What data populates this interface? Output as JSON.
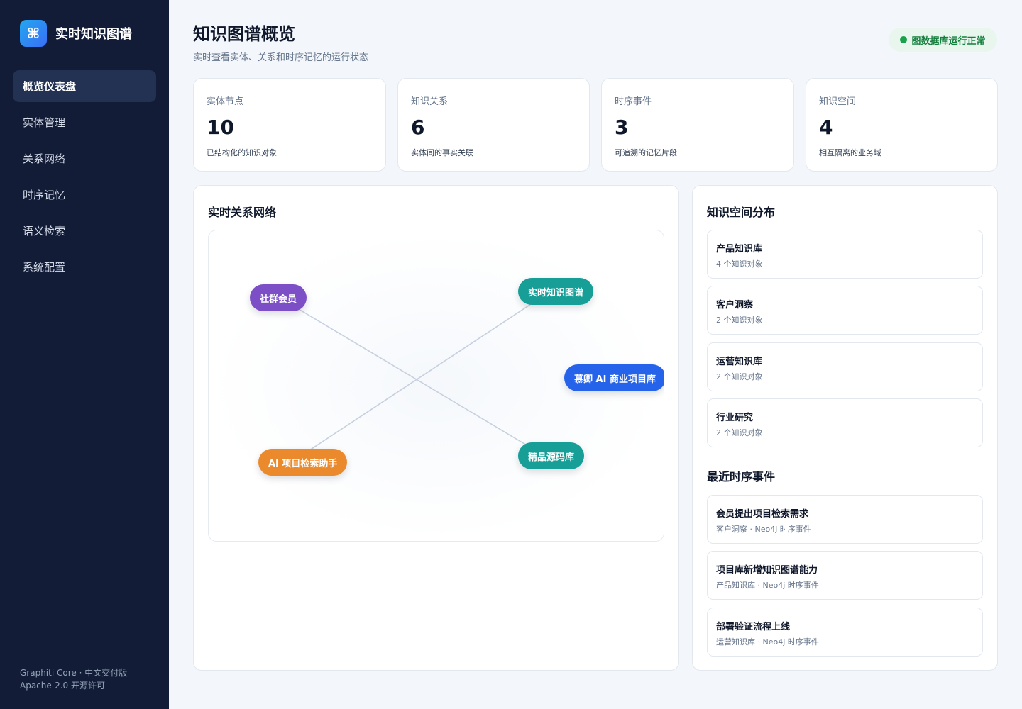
{
  "brand": {
    "logo_glyph": "⌘",
    "title": "实时知识图谱"
  },
  "nav": {
    "items": [
      {
        "label": "概览仪表盘",
        "active": true
      },
      {
        "label": "实体管理"
      },
      {
        "label": "关系网络"
      },
      {
        "label": "时序记忆"
      },
      {
        "label": "语义检索"
      },
      {
        "label": "系统配置"
      }
    ]
  },
  "footer": {
    "line1": "Graphiti Core · 中文交付版",
    "line2": "Apache-2.0 开源许可"
  },
  "header": {
    "title": "知识图谱概览",
    "subtitle": "实时查看实体、关系和时序记忆的运行状态",
    "status": "图数据库运行正常"
  },
  "stats": [
    {
      "label": "实体节点",
      "value": "10",
      "desc": "已结构化的知识对象"
    },
    {
      "label": "知识关系",
      "value": "6",
      "desc": "实体间的事实关联"
    },
    {
      "label": "时序事件",
      "value": "3",
      "desc": "可追溯的记忆片段"
    },
    {
      "label": "知识空间",
      "value": "4",
      "desc": "相互隔离的业务域"
    }
  ],
  "network": {
    "title": "实时关系网络",
    "nodes": [
      {
        "label": "社群会员",
        "color": "#7c4fc6"
      },
      {
        "label": "实时知识图谱",
        "color": "#169e97"
      },
      {
        "label": "慕卿 AI 商业项目库",
        "color": "#2563eb"
      },
      {
        "label": "AI 项目检索助手",
        "color": "#ea8a2c"
      },
      {
        "label": "精品源码库",
        "color": "#169e97"
      }
    ]
  },
  "spaces": {
    "title": "知识空间分布",
    "items": [
      {
        "name": "产品知识库",
        "count": "4 个知识对象"
      },
      {
        "name": "客户洞察",
        "count": "2 个知识对象"
      },
      {
        "name": "运营知识库",
        "count": "2 个知识对象"
      },
      {
        "name": "行业研究",
        "count": "2 个知识对象"
      }
    ]
  },
  "events": {
    "title": "最近时序事件",
    "items": [
      {
        "title": "会员提出项目检索需求",
        "meta": "客户洞察 · Neo4j 时序事件"
      },
      {
        "title": "项目库新增知识图谱能力",
        "meta": "产品知识库 · Neo4j 时序事件"
      },
      {
        "title": "部署验证流程上线",
        "meta": "运营知识库 · Neo4j 时序事件"
      }
    ]
  },
  "colors": {
    "sidebar_bg": "#121c36",
    "accent": "#3b6ef5",
    "status_green": "#16a34a"
  }
}
